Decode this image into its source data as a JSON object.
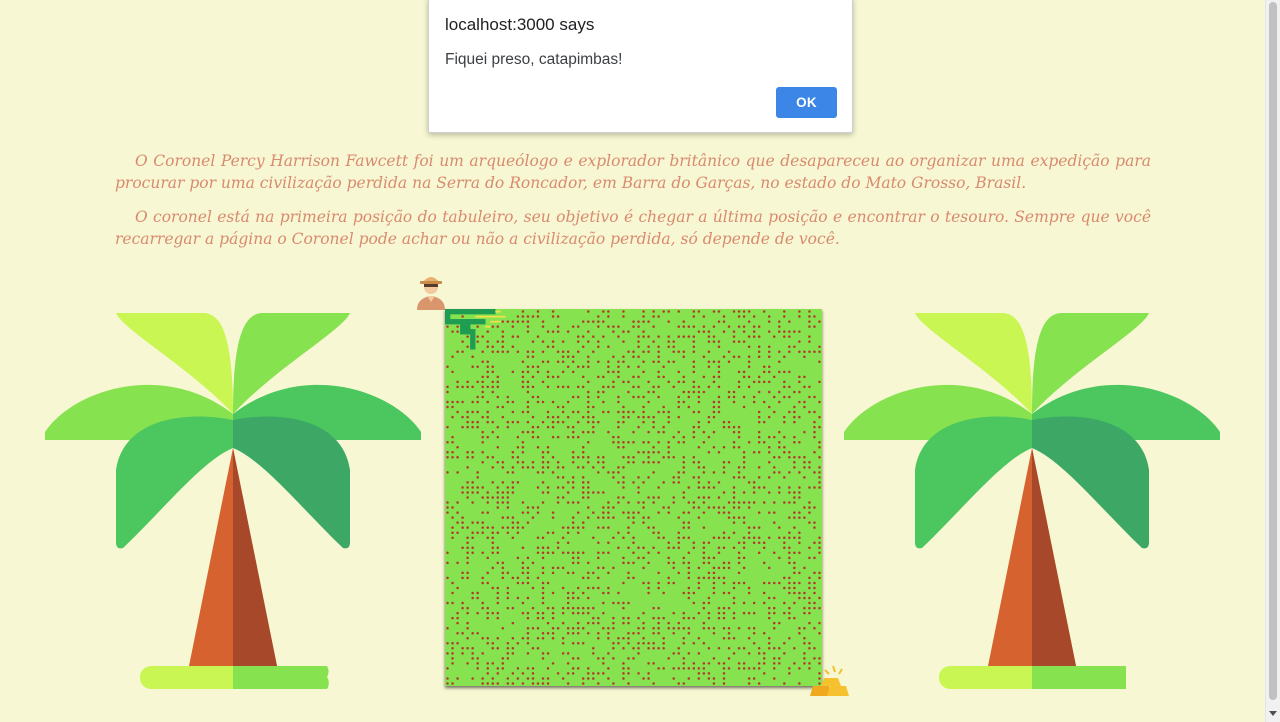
{
  "dialog": {
    "title": "localhost:3000 says",
    "message": "Fiquei preso, catapimbas!",
    "ok_label": "OK"
  },
  "intro": {
    "paragraph1": "O Coronel Percy Harrison Fawcett foi um arqueólogo e explorador britânico que desapareceu ao organizar uma expedição para procurar por uma civilização perdida na Serra do Roncador, em Barra do Garças, no estado do Mato Grosso, Brasil.",
    "paragraph2": "O coronel está na primeira posição do tabuleiro, seu objetivo é chegar a última posição e encontrar o tesouro. Sempre que você recarregar a página o Coronel pode achar ou não a civilização perdida, só depende de você."
  },
  "board": {
    "grid_size": 75,
    "path_cells": [
      [
        0,
        0
      ],
      [
        1,
        0
      ],
      [
        2,
        0
      ],
      [
        3,
        0
      ],
      [
        4,
        0
      ],
      [
        5,
        0
      ],
      [
        6,
        0
      ],
      [
        7,
        0
      ],
      [
        8,
        0
      ],
      [
        9,
        0
      ],
      [
        0,
        1
      ],
      [
        0,
        2
      ],
      [
        1,
        2
      ],
      [
        2,
        2
      ],
      [
        3,
        2
      ],
      [
        4,
        2
      ],
      [
        5,
        2
      ],
      [
        4,
        3
      ],
      [
        4,
        4
      ],
      [
        5,
        4
      ],
      [
        5,
        5
      ],
      [
        5,
        6
      ],
      [
        5,
        7
      ],
      [
        6,
        2
      ],
      [
        7,
        2
      ],
      [
        3,
        3
      ],
      [
        3,
        4
      ]
    ],
    "trail_cells": [
      [
        6,
        1
      ],
      [
        7,
        1
      ],
      [
        8,
        1
      ],
      [
        9,
        1
      ],
      [
        10,
        1
      ],
      [
        9,
        2
      ],
      [
        10,
        0
      ],
      [
        10,
        2
      ],
      [
        11,
        1
      ],
      [
        8,
        3
      ]
    ]
  },
  "colors": {
    "background": "#f7f7d3",
    "text": "#d98a6e",
    "board": "#86e24f",
    "obstacle": "#b2392b",
    "path": "#1e9c52",
    "trail": "#f0e14a",
    "dialog_button": "#3b86e6"
  },
  "icons": {
    "explorer": "explorer-icon",
    "treasure": "gold-bars-icon",
    "palm": "palm-tree-icon"
  }
}
